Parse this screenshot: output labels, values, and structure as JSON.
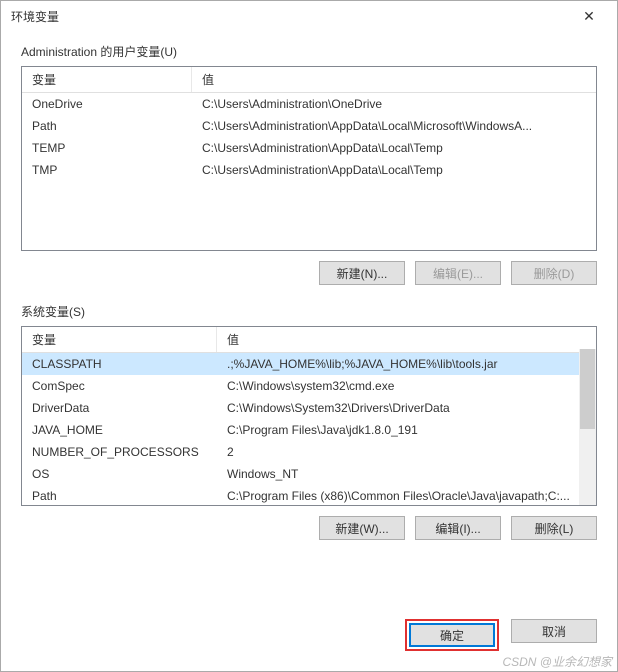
{
  "window": {
    "title": "环境变量"
  },
  "user_section": {
    "label": "Administration 的用户变量(U)",
    "columns": {
      "name": "变量",
      "value": "值"
    },
    "rows": [
      {
        "name": "OneDrive",
        "value": "C:\\Users\\Administration\\OneDrive"
      },
      {
        "name": "Path",
        "value": "C:\\Users\\Administration\\AppData\\Local\\Microsoft\\WindowsA..."
      },
      {
        "name": "TEMP",
        "value": "C:\\Users\\Administration\\AppData\\Local\\Temp"
      },
      {
        "name": "TMP",
        "value": "C:\\Users\\Administration\\AppData\\Local\\Temp"
      }
    ],
    "buttons": {
      "new": "新建(N)...",
      "edit": "编辑(E)...",
      "delete": "删除(D)"
    }
  },
  "system_section": {
    "label": "系统变量(S)",
    "columns": {
      "name": "变量",
      "value": "值"
    },
    "rows": [
      {
        "name": "CLASSPATH",
        "value": ".;%JAVA_HOME%\\lib;%JAVA_HOME%\\lib\\tools.jar"
      },
      {
        "name": "ComSpec",
        "value": "C:\\Windows\\system32\\cmd.exe"
      },
      {
        "name": "DriverData",
        "value": "C:\\Windows\\System32\\Drivers\\DriverData"
      },
      {
        "name": "JAVA_HOME",
        "value": "C:\\Program Files\\Java\\jdk1.8.0_191"
      },
      {
        "name": "NUMBER_OF_PROCESSORS",
        "value": "2"
      },
      {
        "name": "OS",
        "value": "Windows_NT"
      },
      {
        "name": "Path",
        "value": "C:\\Program Files (x86)\\Common Files\\Oracle\\Java\\javapath;C:..."
      }
    ],
    "buttons": {
      "new": "新建(W)...",
      "edit": "编辑(I)...",
      "delete": "删除(L)"
    }
  },
  "footer": {
    "ok": "确定",
    "cancel": "取消"
  },
  "watermark": "CSDN @业余幻想家"
}
